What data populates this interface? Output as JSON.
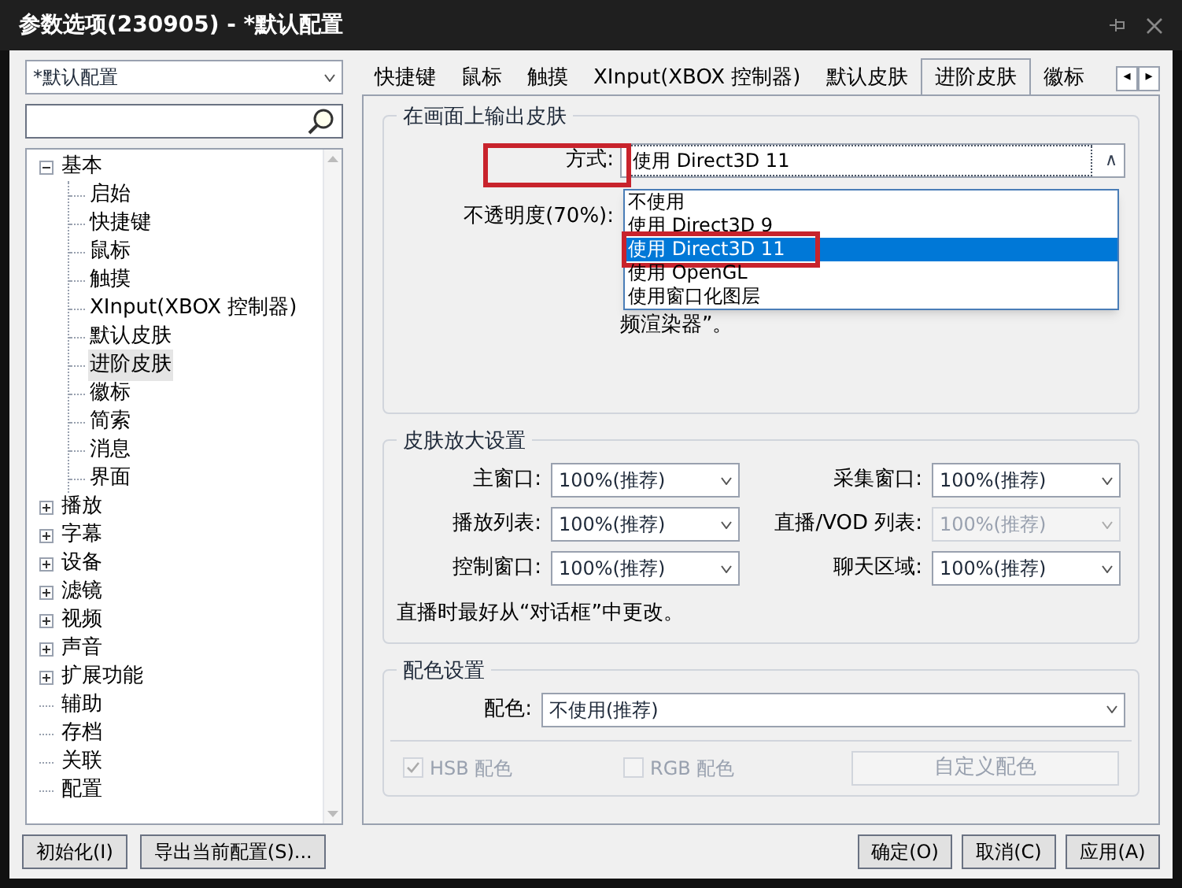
{
  "window": {
    "title": "参数选项(230905) - *默认配置"
  },
  "profile_combo": {
    "value": "*默认配置"
  },
  "tree": [
    {
      "label": "基本",
      "expanded": true,
      "selected": false,
      "children": [
        {
          "label": "启始",
          "selected": false
        },
        {
          "label": "快捷键",
          "selected": false
        },
        {
          "label": "鼠标",
          "selected": false
        },
        {
          "label": "触摸",
          "selected": false
        },
        {
          "label": "XInput(XBOX 控制器)",
          "selected": false
        },
        {
          "label": "默认皮肤",
          "selected": false
        },
        {
          "label": "进阶皮肤",
          "selected": true
        },
        {
          "label": "徽标",
          "selected": false
        },
        {
          "label": "简索",
          "selected": false
        },
        {
          "label": "消息",
          "selected": false
        },
        {
          "label": "界面",
          "selected": false
        }
      ]
    },
    {
      "label": "播放",
      "expanded": false,
      "selected": false
    },
    {
      "label": "字幕",
      "expanded": false,
      "selected": false
    },
    {
      "label": "设备",
      "expanded": false,
      "selected": false
    },
    {
      "label": "滤镜",
      "expanded": false,
      "selected": false
    },
    {
      "label": "视频",
      "expanded": false,
      "selected": false
    },
    {
      "label": "声音",
      "expanded": false,
      "selected": false
    },
    {
      "label": "扩展功能",
      "expanded": false,
      "selected": false
    },
    {
      "label": "辅助",
      "selected": false
    },
    {
      "label": "存档",
      "selected": false
    },
    {
      "label": "关联",
      "selected": false
    },
    {
      "label": "配置",
      "selected": false
    }
  ],
  "left_buttons": [
    "初始化(I)",
    "导出当前配置(S)..."
  ],
  "tabs": [
    {
      "label": "快捷键",
      "selected": false
    },
    {
      "label": "鼠标",
      "selected": false
    },
    {
      "label": "触摸",
      "selected": false
    },
    {
      "label": "XInput(XBOX 控制器)",
      "selected": false
    },
    {
      "label": "默认皮肤",
      "selected": false
    },
    {
      "label": "进阶皮肤",
      "selected": true
    },
    {
      "label": "徽标",
      "selected": false
    }
  ],
  "tab_scroll": [
    "◂",
    "▸"
  ],
  "output_group": {
    "title": "在画面上输出皮肤",
    "method_label": "方式:",
    "method_label_highlighted": true,
    "method_value": "使用 Direct3D 11",
    "method_arrow": "∧",
    "opacity_label": "不透明度(70%):",
    "note_tail": "频渲染器”。",
    "options": [
      {
        "label": "不使用",
        "selected": false,
        "highlighted": false
      },
      {
        "label": "使用 Direct3D 9",
        "selected": false,
        "highlighted": false
      },
      {
        "label": "使用 Direct3D 11",
        "selected": true,
        "highlighted": true
      },
      {
        "label": "使用 OpenGL",
        "selected": false,
        "highlighted": false
      },
      {
        "label": "使用窗口化图层",
        "selected": false,
        "highlighted": false
      }
    ]
  },
  "zoom_group": {
    "title": "皮肤放大设置",
    "fields": [
      {
        "label": "主窗口:",
        "value": "100%(推荐)",
        "disabled": false
      },
      {
        "label": "采集窗口:",
        "value": "100%(推荐)",
        "disabled": false
      },
      {
        "label": "播放列表:",
        "value": "100%(推荐)",
        "disabled": false
      },
      {
        "label": "直播/VOD 列表:",
        "value": "100%(推荐)",
        "disabled": true
      },
      {
        "label": "控制窗口:",
        "value": "100%(推荐)",
        "disabled": false
      },
      {
        "label": "聊天区域:",
        "value": "100%(推荐)",
        "disabled": false
      }
    ],
    "note": "直播时最好从“对话框”中更改。"
  },
  "color_group": {
    "title": "配色设置",
    "label": "配色:",
    "value": "不使用(推荐)",
    "checks": [
      {
        "label": "HSB 配色",
        "checked": true,
        "disabled": true
      },
      {
        "label": "RGB 配色",
        "checked": false,
        "disabled": true
      }
    ],
    "custom_button": {
      "label": "自定义配色",
      "disabled": true
    }
  },
  "bottom_buttons": [
    "确定(O)",
    "取消(C)",
    "应用(A)"
  ]
}
